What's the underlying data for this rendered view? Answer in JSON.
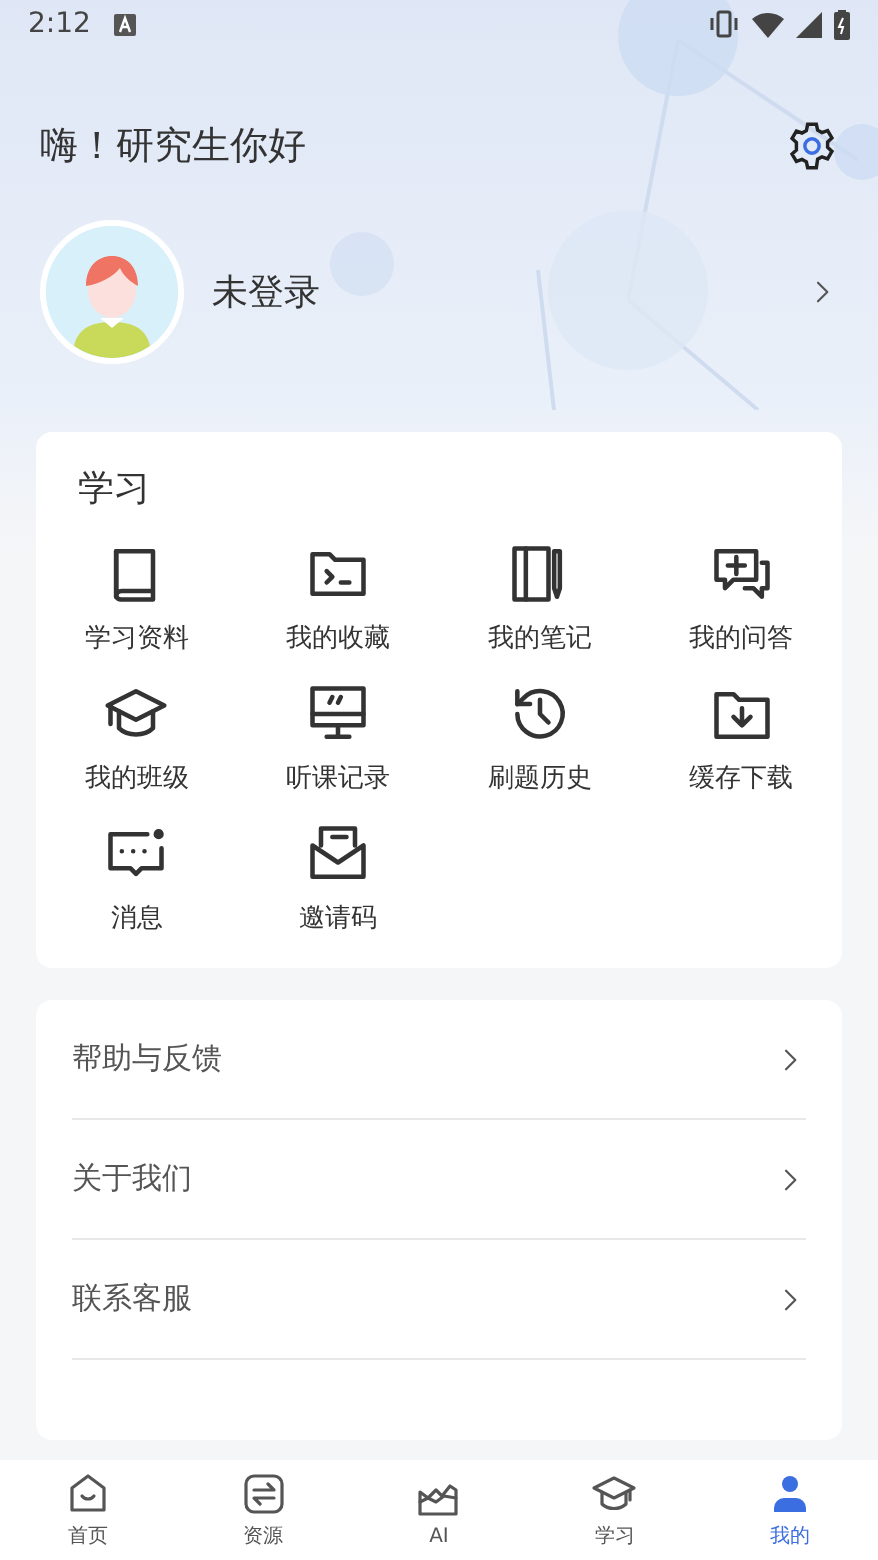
{
  "status_bar": {
    "time": "2:12"
  },
  "header": {
    "greeting": "嗨！研究生你好"
  },
  "profile": {
    "name": "未登录"
  },
  "study_card": {
    "title": "学习",
    "items": [
      {
        "label": "学习资料"
      },
      {
        "label": "我的收藏"
      },
      {
        "label": "我的笔记"
      },
      {
        "label": "我的问答"
      },
      {
        "label": "我的班级"
      },
      {
        "label": "听课记录"
      },
      {
        "label": "刷题历史"
      },
      {
        "label": "缓存下载"
      },
      {
        "label": "消息"
      },
      {
        "label": "邀请码"
      }
    ]
  },
  "menu": [
    {
      "label": "帮助与反馈"
    },
    {
      "label": "关于我们"
    },
    {
      "label": "联系客服"
    }
  ],
  "tab_bar": [
    {
      "label": "首页",
      "selected": false
    },
    {
      "label": "资源",
      "selected": false
    },
    {
      "label": "AI",
      "selected": false
    },
    {
      "label": "学习",
      "selected": false
    },
    {
      "label": "我的",
      "selected": true
    }
  ]
}
